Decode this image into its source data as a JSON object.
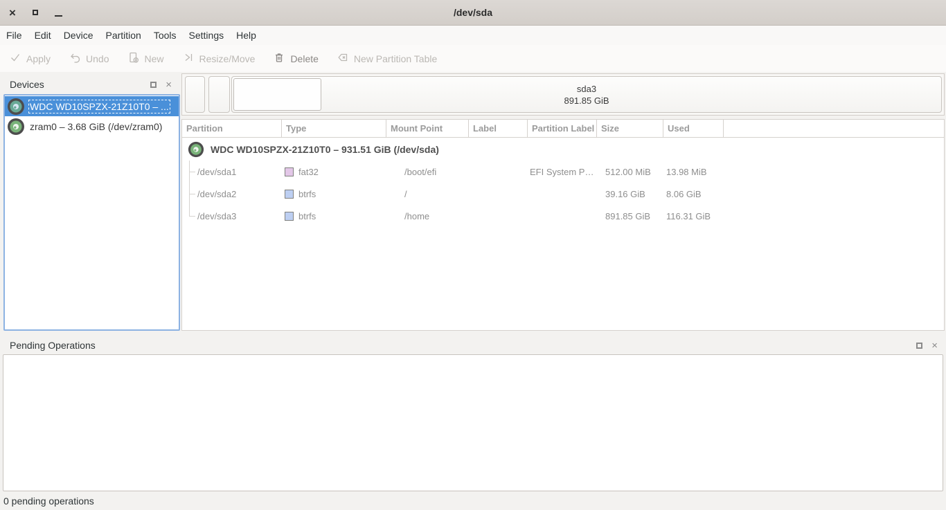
{
  "window": {
    "title": "/dev/sda"
  },
  "menu": {
    "items": [
      "File",
      "Edit",
      "Device",
      "Partition",
      "Tools",
      "Settings",
      "Help"
    ]
  },
  "toolbar": {
    "apply": "Apply",
    "undo": "Undo",
    "new": "New",
    "resize_move": "Resize/Move",
    "delete": "Delete",
    "new_partition_table": "New Partition Table"
  },
  "devices": {
    "title": "Devices",
    "items": [
      {
        "label": "WDC WD10SPZX-21Z10T0 – ...",
        "selected": true
      },
      {
        "label": "zram0 – 3.68 GiB (/dev/zram0)",
        "selected": false
      }
    ]
  },
  "partition_bar": {
    "selected_name": "sda3",
    "selected_size": "891.85 GiB"
  },
  "table": {
    "columns": [
      "Partition",
      "Type",
      "Mount Point",
      "Label",
      "Partition Label",
      "Size",
      "Used"
    ],
    "device_row": "WDC WD10SPZX-21Z10T0 – 931.51 GiB (/dev/sda)",
    "rows": [
      {
        "partition": "/dev/sda1",
        "type": "fat32",
        "type_color": "#e3c7e8",
        "mount": "/boot/efi",
        "label": "",
        "partition_label": "EFI System P…",
        "size": "512.00 MiB",
        "used": "13.98 MiB"
      },
      {
        "partition": "/dev/sda2",
        "type": "btrfs",
        "type_color": "#bdcff2",
        "mount": "/",
        "label": "",
        "partition_label": "",
        "size": "39.16 GiB",
        "used": "8.06 GiB"
      },
      {
        "partition": "/dev/sda3",
        "type": "btrfs",
        "type_color": "#bdcff2",
        "mount": "/home",
        "label": "",
        "partition_label": "",
        "size": "891.85 GiB",
        "used": "116.31 GiB"
      }
    ]
  },
  "pending": {
    "title": "Pending Operations"
  },
  "statusbar": {
    "text": "0 pending operations"
  },
  "colors": {
    "selection_blue": "#4a90d9",
    "focus_border_blue": "#8cb2e2",
    "fat32_swatch": "#e3c7e8",
    "btrfs_swatch": "#bdcff2",
    "disk_icon_green": "#79b379"
  }
}
